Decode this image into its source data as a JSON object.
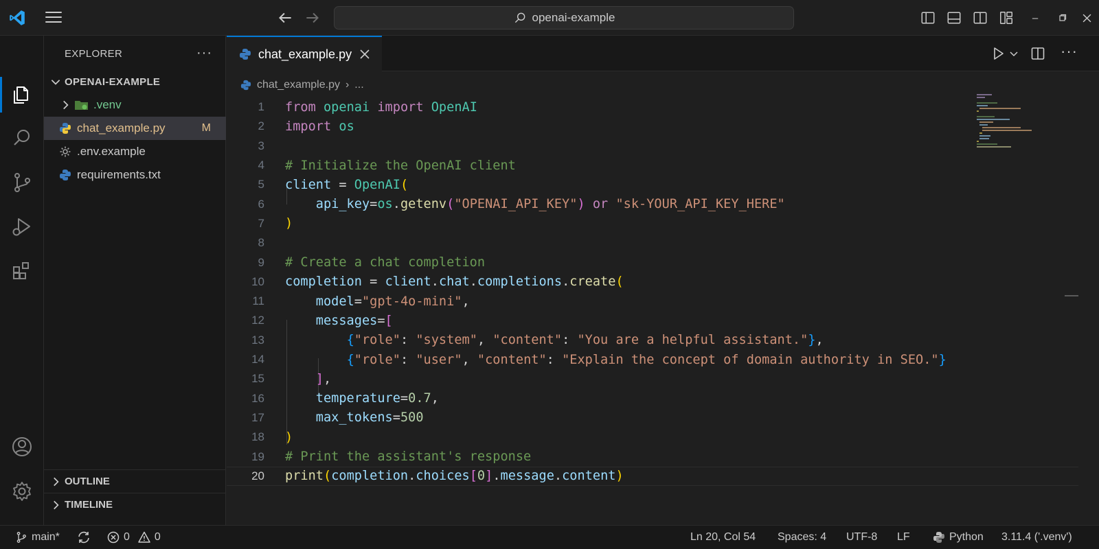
{
  "titlebar": {
    "search_text": "openai-example"
  },
  "sidebar": {
    "title": "EXPLORER",
    "more": "···",
    "project": "OPENAI-EXAMPLE",
    "files": [
      {
        "name": ".venv",
        "type": "folder",
        "badge": ""
      },
      {
        "name": "chat_example.py",
        "type": "python",
        "badge": "M"
      },
      {
        "name": ".env.example",
        "type": "gear",
        "badge": ""
      },
      {
        "name": "requirements.txt",
        "type": "python",
        "badge": ""
      }
    ],
    "sections": [
      "OUTLINE",
      "TIMELINE"
    ]
  },
  "editor": {
    "tab_label": "chat_example.py",
    "breadcrumb": {
      "file": "chat_example.py",
      "sep": "›",
      "rest": "..."
    },
    "line_numbers": [
      "1",
      "2",
      "3",
      "4",
      "5",
      "6",
      "7",
      "8",
      "9",
      "10",
      "11",
      "12",
      "13",
      "14",
      "15",
      "16",
      "17",
      "18",
      "19",
      "20"
    ],
    "current_line": 20
  },
  "statusbar": {
    "branch": "main*",
    "errors": "0",
    "warnings": "0",
    "position": "Ln 20, Col 54",
    "spaces": "Spaces: 4",
    "encoding": "UTF-8",
    "eol": "LF",
    "language": "Python",
    "interpreter": "3.11.4 ('.venv')"
  },
  "colors": {
    "accent": "#0078d4",
    "keyword": "#c586c0",
    "string": "#ce9178",
    "comment": "#6a9955",
    "function": "#dcdcaa",
    "class": "#4ec9b0",
    "variable": "#9cdcfe",
    "number": "#b5cea8",
    "modified": "#e2c08d"
  }
}
